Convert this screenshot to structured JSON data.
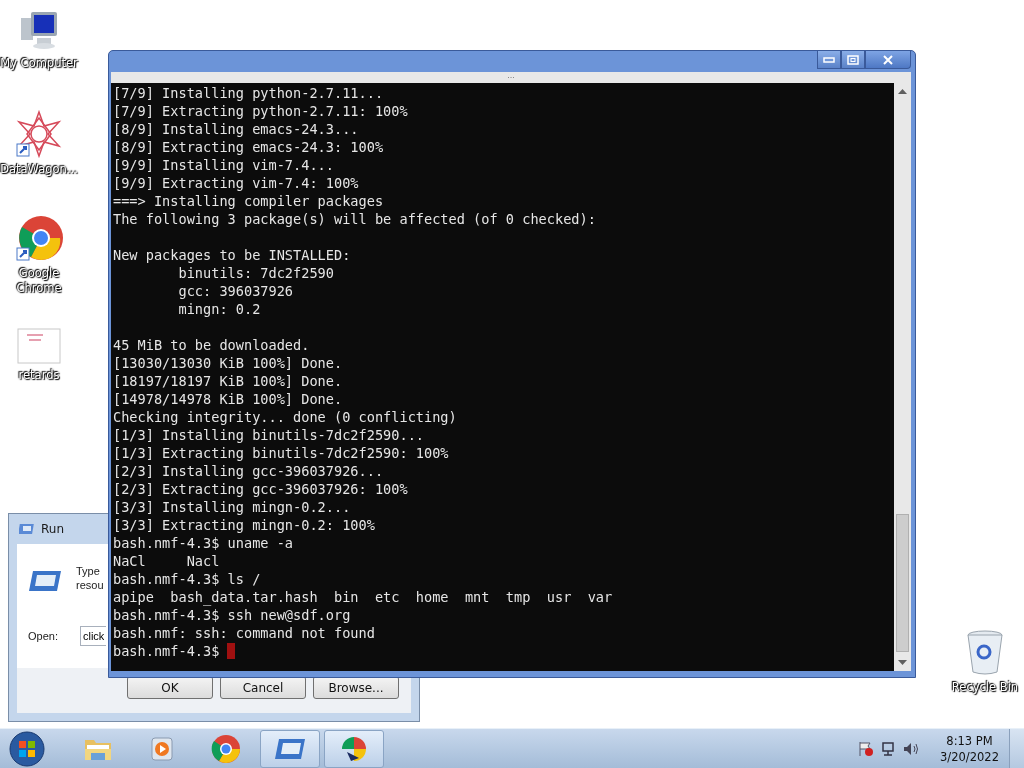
{
  "desktop_icons": [
    {
      "label": "My Computer",
      "kind": "computer"
    },
    {
      "label": "DataWagon...",
      "kind": "star"
    },
    {
      "label": "Google Chrome",
      "kind": "chrome"
    },
    {
      "label": "retards",
      "kind": "document"
    },
    {
      "label": "Recycle Bin",
      "kind": "bin"
    }
  ],
  "run_dialog": {
    "title": "Run",
    "prompt_lines": [
      "Type",
      "resou"
    ],
    "open_label": "Open:",
    "open_value": "click",
    "buttons": [
      "OK",
      "Cancel",
      "Browse..."
    ]
  },
  "terminal": {
    "grip": "...",
    "blocks": [
      [
        "[7/9] Installing python-2.7.11...",
        "[7/9] Extracting python-2.7.11: 100%",
        "[8/9] Installing emacs-24.3...",
        "[8/9] Extracting emacs-24.3: 100%",
        "[9/9] Installing vim-7.4...",
        "[9/9] Extracting vim-7.4: 100%",
        "===> Installing compiler packages",
        "The following 3 package(s) will be affected (of 0 checked):"
      ],
      [
        "New packages to be INSTALLED:",
        "        binutils: 7dc2f2590",
        "        gcc: 396037926",
        "        mingn: 0.2"
      ],
      [
        "45 MiB to be downloaded.",
        "[13030/13030 KiB 100%] Done.",
        "[18197/18197 KiB 100%] Done.",
        "[14978/14978 KiB 100%] Done.",
        "Checking integrity... done (0 conflicting)",
        "[1/3] Installing binutils-7dc2f2590...",
        "[1/3] Extracting binutils-7dc2f2590: 100%",
        "[2/3] Installing gcc-396037926...",
        "[2/3] Extracting gcc-396037926: 100%",
        "[3/3] Installing mingn-0.2...",
        "[3/3] Extracting mingn-0.2: 100%",
        "bash.nmf-4.3$ uname -a",
        "NaCl     Nacl",
        "bash.nmf-4.3$ ls /",
        "apipe  bash_data.tar.hash  bin  etc  home  mnt  tmp  usr  var",
        "bash.nmf-4.3$ ssh new@sdf.org",
        "bash.nmf: ssh: command not found"
      ]
    ],
    "prompt": "bash.nmf-4.3$"
  },
  "taskbar": {
    "apps": [
      {
        "kind": "start",
        "selected": false
      },
      {
        "kind": "folder",
        "selected": false
      },
      {
        "kind": "media",
        "selected": false
      },
      {
        "kind": "chrome",
        "selected": false
      },
      {
        "kind": "run",
        "selected": true
      },
      {
        "kind": "chromebeta",
        "selected": true
      }
    ],
    "time": "8:13 PM",
    "date": "3/20/2022"
  }
}
